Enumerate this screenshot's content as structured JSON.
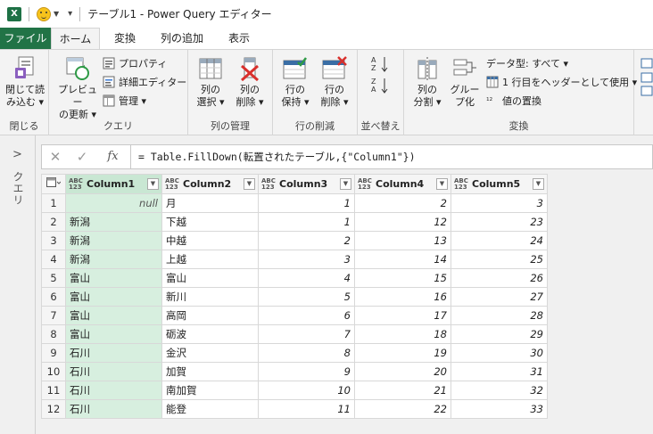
{
  "title": "テーブル1 - Power Query エディター",
  "tabs": [
    "ファイル",
    "ホーム",
    "変換",
    "列の追加",
    "表示"
  ],
  "ribbon": {
    "close_group": {
      "load_label_1": "閉じて読",
      "load_label_2": "み込む ▾",
      "group": "閉じる"
    },
    "query_group": {
      "refresh_1": "プレビュー",
      "refresh_2": "の更新 ▾",
      "properties": "プロパティ",
      "advanced_editor": "詳細エディター",
      "manage": "管理 ▾",
      "group": "クエリ"
    },
    "columns_group": {
      "choose_1": "列の",
      "choose_2": "選択 ▾",
      "remove_1": "列の",
      "remove_2": "削除 ▾",
      "group": "列の管理"
    },
    "rows_group": {
      "keep_1": "行の",
      "keep_2": "保持 ▾",
      "remove_1": "行の",
      "remove_2": "削除 ▾",
      "group": "行の削減"
    },
    "sort_group": {
      "group": "並べ替え"
    },
    "transform_group": {
      "split_1": "列の",
      "split_2": "分割 ▾",
      "group_by_1": "グルー",
      "group_by_2": "プ化",
      "data_type": "データ型: すべて ▾",
      "use_first_row": "1 行目をヘッダーとして使用 ▾",
      "replace_values": "値の置換",
      "group": "変換"
    }
  },
  "query_pane": {
    "label": "クエリ"
  },
  "formula_bar": {
    "cancel": "✕",
    "commit": "✓",
    "fx": "fx",
    "formula": "= Table.FillDown(転置されたテーブル,{\"Column1\"})"
  },
  "grid": {
    "type_label": "ABC\n123",
    "columns": [
      "Column1",
      "Column2",
      "Column3",
      "Column4",
      "Column5"
    ],
    "rows": [
      [
        "1",
        "null",
        "月",
        "1",
        "2",
        "3"
      ],
      [
        "2",
        "新潟",
        "下越",
        "1",
        "12",
        "23"
      ],
      [
        "3",
        "新潟",
        "中越",
        "2",
        "13",
        "24"
      ],
      [
        "4",
        "新潟",
        "上越",
        "3",
        "14",
        "25"
      ],
      [
        "5",
        "富山",
        "富山",
        "4",
        "15",
        "26"
      ],
      [
        "6",
        "富山",
        "新川",
        "5",
        "16",
        "27"
      ],
      [
        "7",
        "富山",
        "高岡",
        "6",
        "17",
        "28"
      ],
      [
        "8",
        "富山",
        "砺波",
        "7",
        "18",
        "29"
      ],
      [
        "9",
        "石川",
        "金沢",
        "8",
        "19",
        "30"
      ],
      [
        "10",
        "石川",
        "加賀",
        "9",
        "20",
        "31"
      ],
      [
        "11",
        "石川",
        "南加賀",
        "10",
        "21",
        "32"
      ],
      [
        "12",
        "石川",
        "能登",
        "11",
        "22",
        "33"
      ]
    ]
  },
  "colors": {
    "file_tab": "#217346",
    "fill_column": "#d7efdf",
    "ribbon_bg": "#f3f3f3"
  }
}
